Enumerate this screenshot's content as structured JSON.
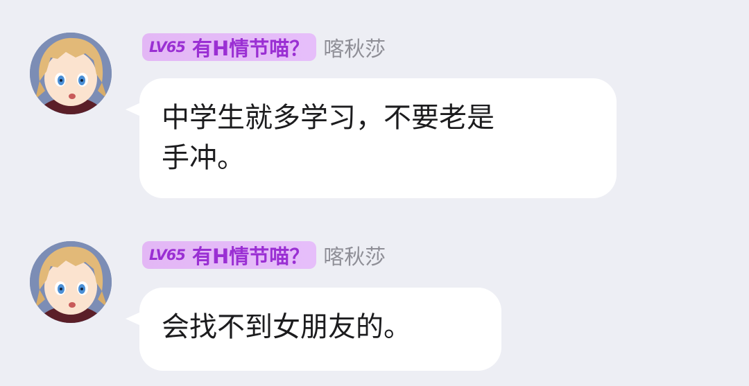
{
  "messages": [
    {
      "level": "LV65",
      "title": "有H情节喵？",
      "nickname": "喀秋莎",
      "lines": [
        "中学生就多学习，不要老是",
        "手冲。"
      ],
      "avatar": "anime-girl-avatar"
    },
    {
      "level": "LV65",
      "title": "有H情节喵？",
      "nickname": "喀秋莎",
      "lines": [
        "会找不到女朋友的。"
      ],
      "avatar": "anime-girl-avatar"
    }
  ],
  "colors": {
    "background": "#edeef4",
    "badge": "#e3b7f5",
    "badge_text": "#9a2fd3",
    "nickname": "#8e8e96",
    "bubble": "#ffffff"
  }
}
